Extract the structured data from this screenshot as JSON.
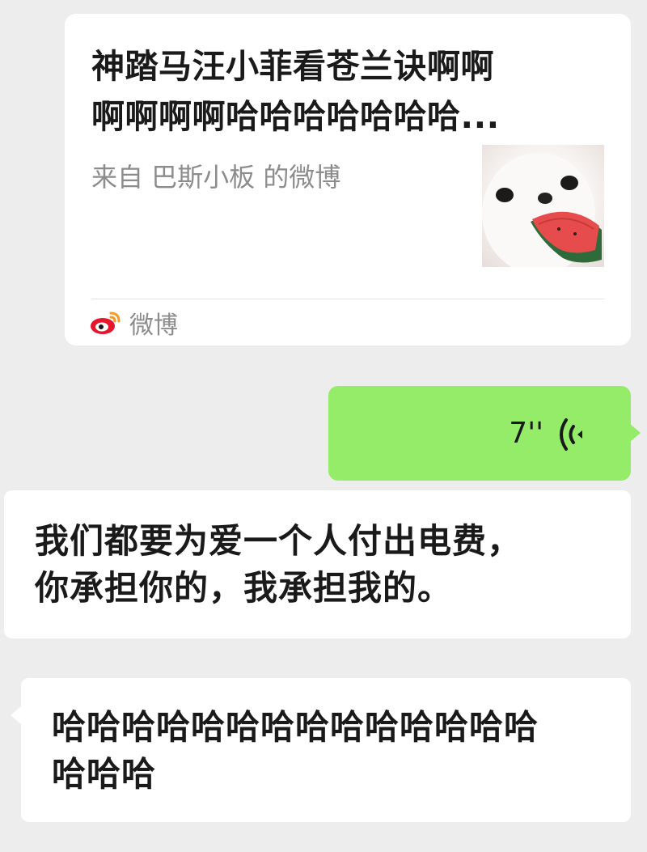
{
  "share_card": {
    "title_line1": "神踏马汪小菲看苍兰诀啊啊",
    "title_line2": "啊啊啊啊哈哈哈哈哈哈哈...",
    "source": "来自 巴斯小板 的微博",
    "thumbnail_icon": "puppy-eating-watermelon-image",
    "app_label": "微博",
    "app_icon": "weibo-logo-icon"
  },
  "voice_message": {
    "duration": "7''",
    "icon": "voice-wave-icon",
    "bubble_color": "#95ec69"
  },
  "messages": [
    {
      "line1": "我们都要为爱一个人付出电费，",
      "line2": "你承担你的，我承担我的。"
    },
    {
      "line1": "哈哈哈哈哈哈哈哈哈哈哈哈哈哈",
      "line2": "哈哈哈"
    }
  ],
  "colors": {
    "background": "#ededed",
    "incoming_bubble": "#ffffff",
    "outgoing_bubble": "#95ec69",
    "secondary_text": "#8c8c8c"
  }
}
